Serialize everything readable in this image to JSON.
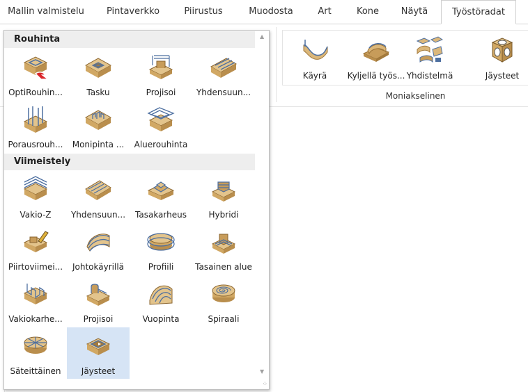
{
  "tabs": [
    {
      "label": "Mallin valmistelu",
      "active": false
    },
    {
      "label": "Pintaverkko",
      "active": false
    },
    {
      "label": "Piirustus",
      "active": false
    },
    {
      "label": "Muodosta",
      "active": false
    },
    {
      "label": "Art",
      "active": false
    },
    {
      "label": "Kone",
      "active": false
    },
    {
      "label": "Näytä",
      "active": false
    },
    {
      "label": "Työstöradat",
      "active": true
    }
  ],
  "ribbon": {
    "group_label": "Moniakselinen",
    "buttons": [
      {
        "label": "Käyrä",
        "icon": "curve-toolpath-icon"
      },
      {
        "label": "Kyljellä työs...",
        "icon": "swarf-toolpath-icon"
      },
      {
        "label": "Yhdistelmä",
        "icon": "combination-toolpath-icon"
      },
      {
        "label": "Jäysteet",
        "icon": "burr-cube-icon"
      }
    ]
  },
  "dropdown": {
    "sections": [
      {
        "title": "Rouhinta",
        "items": [
          {
            "label": "OptiRouhin...",
            "icon": "opti-roughing-icon"
          },
          {
            "label": "Tasku",
            "icon": "pocket-icon"
          },
          {
            "label": "Projisoi",
            "icon": "project-roughing-icon"
          },
          {
            "label": "Yhdensuun...",
            "icon": "parallel-roughing-icon"
          },
          {
            "label": "Porausrouh...",
            "icon": "drill-roughing-icon"
          },
          {
            "label": "Monipinta ...",
            "icon": "multi-surface-icon"
          },
          {
            "label": "Aluerouhinta",
            "icon": "area-roughing-icon"
          }
        ]
      },
      {
        "title": "Viimeistely",
        "items": [
          {
            "label": "Vakio-Z",
            "icon": "constant-z-icon"
          },
          {
            "label": "Yhdensuun...",
            "icon": "parallel-finish-icon"
          },
          {
            "label": "Tasakarheus",
            "icon": "constant-scallop-icon"
          },
          {
            "label": "Hybridi",
            "icon": "hybrid-icon"
          },
          {
            "label": "Piirtoviimei...",
            "icon": "drawing-finish-icon"
          },
          {
            "label": "Johtokäyrillä",
            "icon": "guide-curves-icon"
          },
          {
            "label": "Profiili",
            "icon": "profile-icon"
          },
          {
            "label": "Tasainen alue",
            "icon": "flat-area-icon"
          },
          {
            "label": "Vakiokarhe...",
            "icon": "constant-roughness-icon"
          },
          {
            "label": "Projisoi",
            "icon": "project-finish-icon"
          },
          {
            "label": "Vuopinta",
            "icon": "flow-surface-icon"
          },
          {
            "label": "Spiraali",
            "icon": "spiral-icon"
          },
          {
            "label": "Säteittäinen",
            "icon": "radial-icon"
          },
          {
            "label": "Jäysteet",
            "icon": "burr-icon",
            "selected": true
          }
        ]
      }
    ]
  },
  "colors": {
    "wood": "#dbb77a",
    "wood_dark": "#b98e4d",
    "toolpath": "#4d6fa0",
    "selected_bg": "#d6e4f5",
    "accent_red": "#d9252a"
  }
}
